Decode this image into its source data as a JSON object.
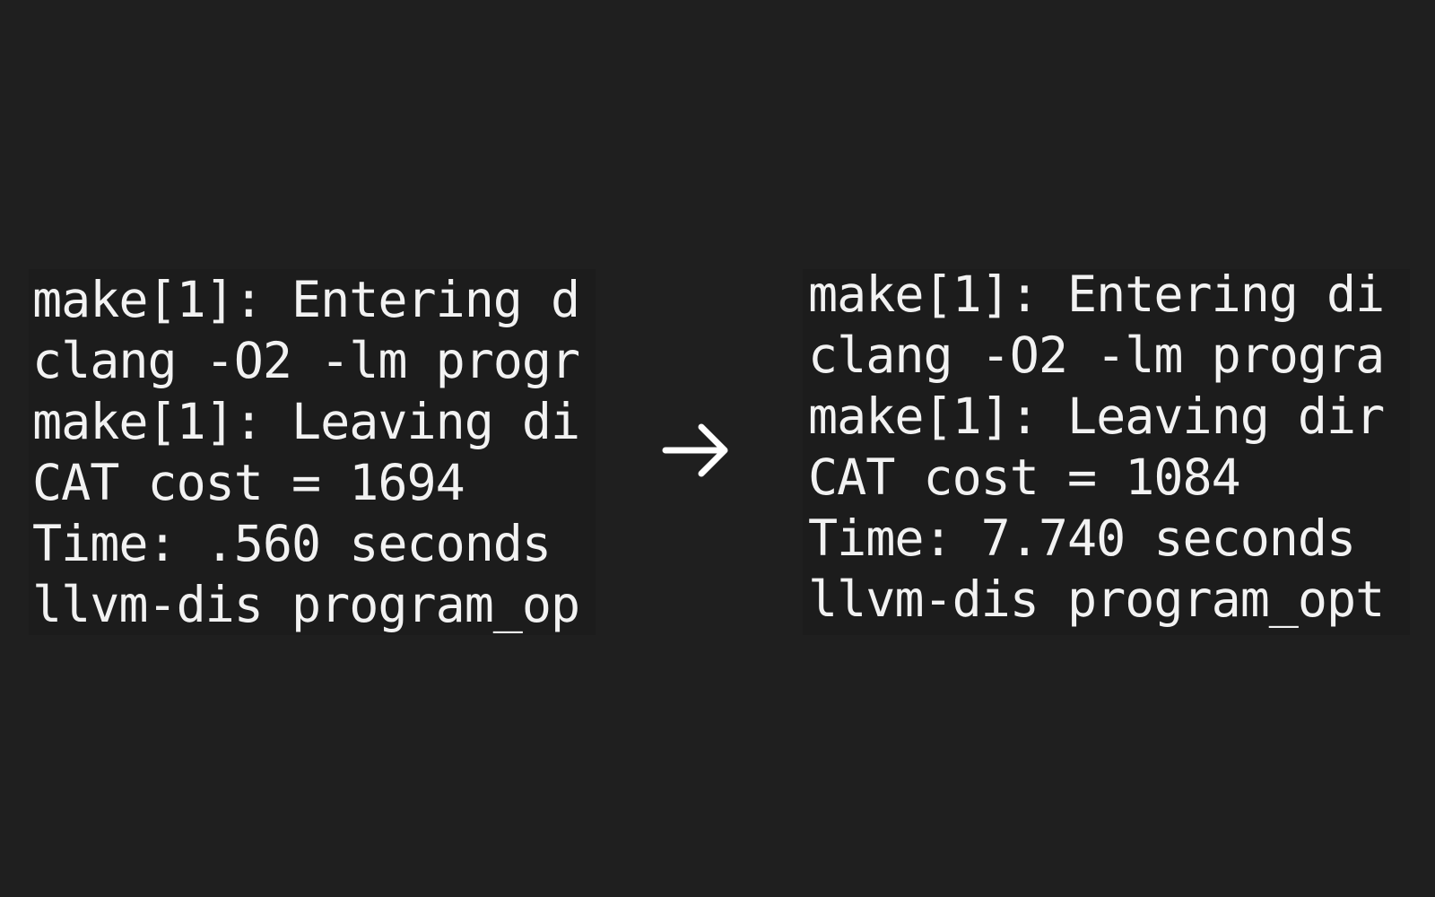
{
  "before": {
    "lines": [
      "make[1]: Entering d",
      "clang -O2 -lm progr",
      "make[1]: Leaving di",
      "CAT cost = 1694",
      "Time: .560 seconds",
      "llvm-dis program_op"
    ]
  },
  "after": {
    "lines": [
      "make[1]: Entering di",
      "clang -O2 -lm progra",
      "make[1]: Leaving dir",
      "CAT cost = 1084",
      "Time: 7.740 seconds",
      "llvm-dis program_opt"
    ]
  },
  "arrow": {
    "icon": "arrow-right-icon",
    "color": "#ffffff"
  }
}
